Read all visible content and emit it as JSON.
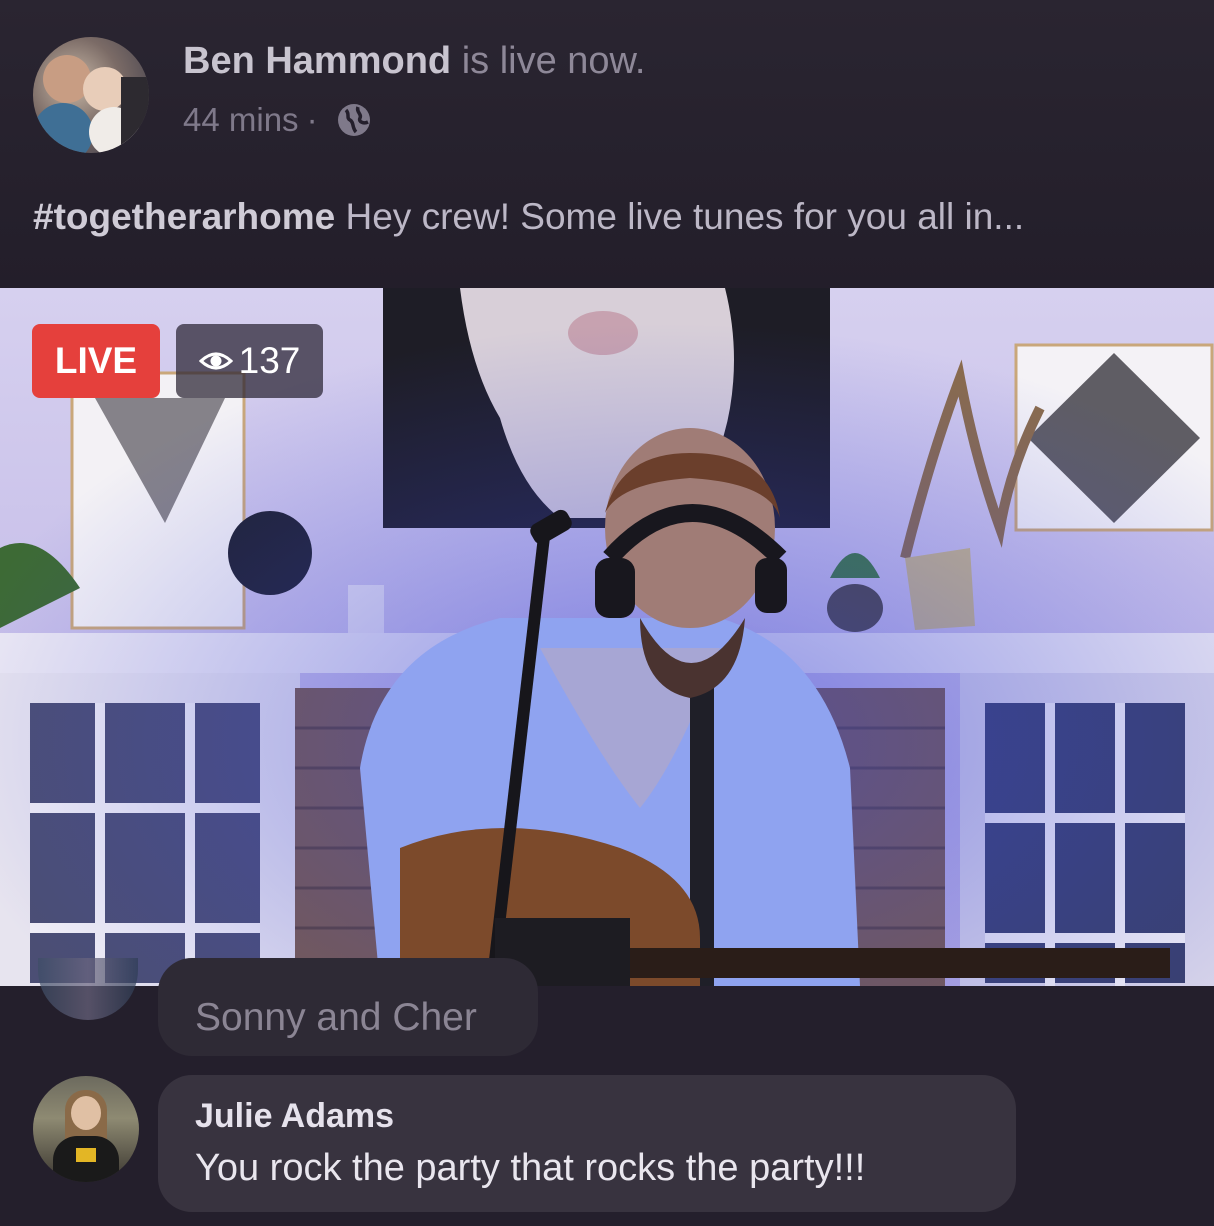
{
  "post": {
    "author": "Ben Hammond",
    "status": " is live now.",
    "time": "44 mins",
    "separator": "·",
    "privacy_icon": "globe-icon",
    "hashtag": "#togetherarhome",
    "caption": " Hey crew! Some live tunes for you all in..."
  },
  "video": {
    "live_label": "LIVE",
    "viewer_icon": "eye-icon",
    "viewer_count": "137",
    "live_color": "#e5403c"
  },
  "comments": [
    {
      "author": "",
      "text": "Sonny and Cher"
    },
    {
      "author": "Julie Adams",
      "text": "You rock the party that rocks the party!!!"
    }
  ]
}
